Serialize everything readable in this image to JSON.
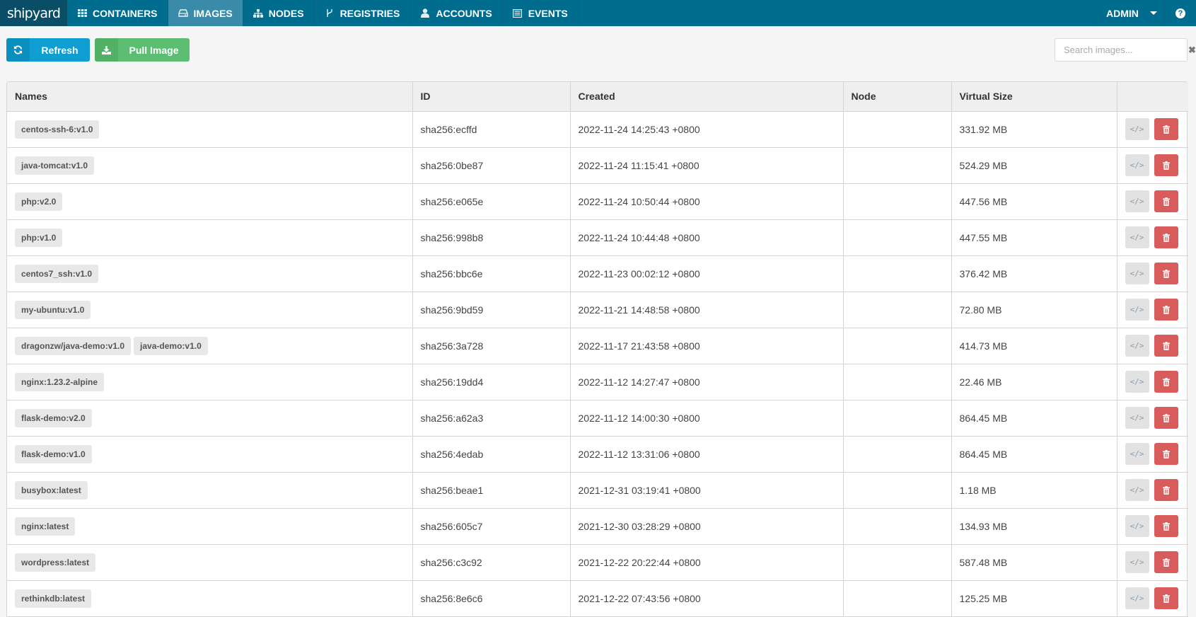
{
  "nav": {
    "logo": "shipyard",
    "items": [
      {
        "label": "CONTAINERS",
        "icon": "grid-icon",
        "active": false
      },
      {
        "label": "IMAGES",
        "icon": "hdd-icon",
        "active": true
      },
      {
        "label": "NODES",
        "icon": "sitemap-icon",
        "active": false
      },
      {
        "label": "REGISTRIES",
        "icon": "fork-icon",
        "active": false
      },
      {
        "label": "ACCOUNTS",
        "icon": "user-icon",
        "active": false
      },
      {
        "label": "EVENTS",
        "icon": "list-icon",
        "active": false
      }
    ],
    "user": "ADMIN",
    "help_icon": "?"
  },
  "toolbar": {
    "refresh_label": "Refresh",
    "pull_label": "Pull Image",
    "search_placeholder": "Search images...",
    "search_value": "",
    "clear_icon": "✖"
  },
  "table": {
    "headers": [
      "Names",
      "ID",
      "Created",
      "Node",
      "Virtual Size",
      ""
    ],
    "rows": [
      {
        "names": [
          "centos-ssh-6:v1.0"
        ],
        "id": "sha256:ecffd",
        "created": "2022-11-24 14:25:43 +0800",
        "node": "",
        "size": "331.92 MB"
      },
      {
        "names": [
          "java-tomcat:v1.0"
        ],
        "id": "sha256:0be87",
        "created": "2022-11-24 11:15:41 +0800",
        "node": "",
        "size": "524.29 MB"
      },
      {
        "names": [
          "php:v2.0"
        ],
        "id": "sha256:e065e",
        "created": "2022-11-24 10:50:44 +0800",
        "node": "",
        "size": "447.56 MB"
      },
      {
        "names": [
          "php:v1.0"
        ],
        "id": "sha256:998b8",
        "created": "2022-11-24 10:44:48 +0800",
        "node": "",
        "size": "447.55 MB"
      },
      {
        "names": [
          "centos7_ssh:v1.0"
        ],
        "id": "sha256:bbc6e",
        "created": "2022-11-23 00:02:12 +0800",
        "node": "",
        "size": "376.42 MB"
      },
      {
        "names": [
          "my-ubuntu:v1.0"
        ],
        "id": "sha256:9bd59",
        "created": "2022-11-21 14:48:58 +0800",
        "node": "",
        "size": "72.80 MB"
      },
      {
        "names": [
          "dragonzw/java-demo:v1.0",
          "java-demo:v1.0"
        ],
        "id": "sha256:3a728",
        "created": "2022-11-17 21:43:58 +0800",
        "node": "",
        "size": "414.73 MB"
      },
      {
        "names": [
          "nginx:1.23.2-alpine"
        ],
        "id": "sha256:19dd4",
        "created": "2022-11-12 14:27:47 +0800",
        "node": "",
        "size": "22.46 MB"
      },
      {
        "names": [
          "flask-demo:v2.0"
        ],
        "id": "sha256:a62a3",
        "created": "2022-11-12 14:00:30 +0800",
        "node": "",
        "size": "864.45 MB"
      },
      {
        "names": [
          "flask-demo:v1.0"
        ],
        "id": "sha256:4edab",
        "created": "2022-11-12 13:31:06 +0800",
        "node": "",
        "size": "864.45 MB"
      },
      {
        "names": [
          "busybox:latest"
        ],
        "id": "sha256:beae1",
        "created": "2021-12-31 03:19:41 +0800",
        "node": "",
        "size": "1.18 MB"
      },
      {
        "names": [
          "nginx:latest"
        ],
        "id": "sha256:605c7",
        "created": "2021-12-30 03:28:29 +0800",
        "node": "",
        "size": "134.93 MB"
      },
      {
        "names": [
          "wordpress:latest"
        ],
        "id": "sha256:c3c92",
        "created": "2021-12-22 20:22:44 +0800",
        "node": "",
        "size": "587.48 MB"
      },
      {
        "names": [
          "rethinkdb:latest"
        ],
        "id": "sha256:8e6c6",
        "created": "2021-12-22 07:43:56 +0800",
        "node": "",
        "size": "125.25 MB"
      }
    ],
    "inspect_glyph": "</>"
  },
  "colors": {
    "navbar": "#006d8f",
    "navbar_active": "#3a8ba9",
    "logo_bg": "#0a4d66",
    "refresh": "#0e9ed1",
    "pull": "#5cbe73",
    "delete": "#d95c5c"
  }
}
